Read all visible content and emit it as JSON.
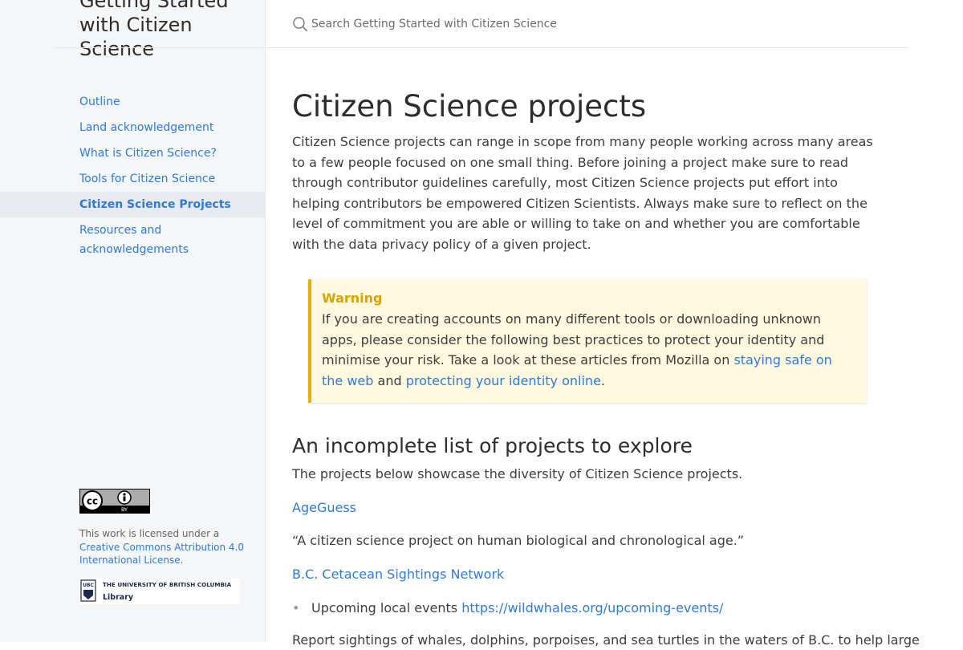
{
  "sidebar": {
    "site_title": "Getting Started with Citizen Science",
    "nav": [
      {
        "label": "Outline"
      },
      {
        "label": "Land acknowledgement"
      },
      {
        "label": "What is Citizen Science?"
      },
      {
        "label": "Tools for Citizen Science"
      },
      {
        "label": "Citizen Science Projects",
        "active": true
      },
      {
        "label": "Resources and acknowledgements"
      }
    ],
    "license_prefix": "This work is licensed under a",
    "license_link": "Creative Commons Attribution 4.0 International License",
    "license_suffix": ".",
    "cc_badge": {
      "text": "cc",
      "by": "BY"
    },
    "ubc_logo": {
      "mark": "UBC",
      "line1": "THE UNIVERSITY OF BRITISH COLUMBIA",
      "line2": "Library"
    }
  },
  "search": {
    "placeholder": "Search Getting Started with Citizen Science",
    "icon": "search-icon"
  },
  "main": {
    "title": "Citizen Science projects",
    "intro": "Citizen Science projects can range in scope from many people working across many areas to a few people focused on one small thing. Before joining a project make sure to read through contributor guidelines carefully, most Citizen Science projects put effort into helping contributors be empowered Citizen Scientists. Always make sure to reflect on the level of commitment you are able or willing to take on and whether you are comfortable with the data privacy policy of a given project.",
    "warning": {
      "title": "Warning",
      "body_start": "If you are creating accounts on many different tools or downloading unknown apps, please consider the following best practices to protect your identity and minimise your risk. Take a look at these articles from Mozilla on ",
      "link1": "staying safe on the web",
      "middle": " and ",
      "link2": "protecting your identity online",
      "end": "."
    },
    "subheading": "An incomplete list of projects to explore",
    "lead": "The projects below showcase the diversity of Citizen Science projects.",
    "projects": [
      {
        "name": "AgeGuess",
        "quote": "“A citizen science project on human biological and chronological age.”"
      },
      {
        "name": "B.C. Cetacean Sightings Network",
        "bullet_label": "Upcoming local events ",
        "bullet_link": "https://wildwhales.org/upcoming-events/"
      }
    ],
    "cut_text": "Report sightings of whales, dolphins, porpoises, and sea turtles in the waters of B.C. to help large"
  },
  "colors": {
    "accent": "#2f7bd0",
    "warning_border": "#e9b100",
    "warning_bg": "#fff9e0",
    "sidebar_bg": "#f5f6f8"
  }
}
